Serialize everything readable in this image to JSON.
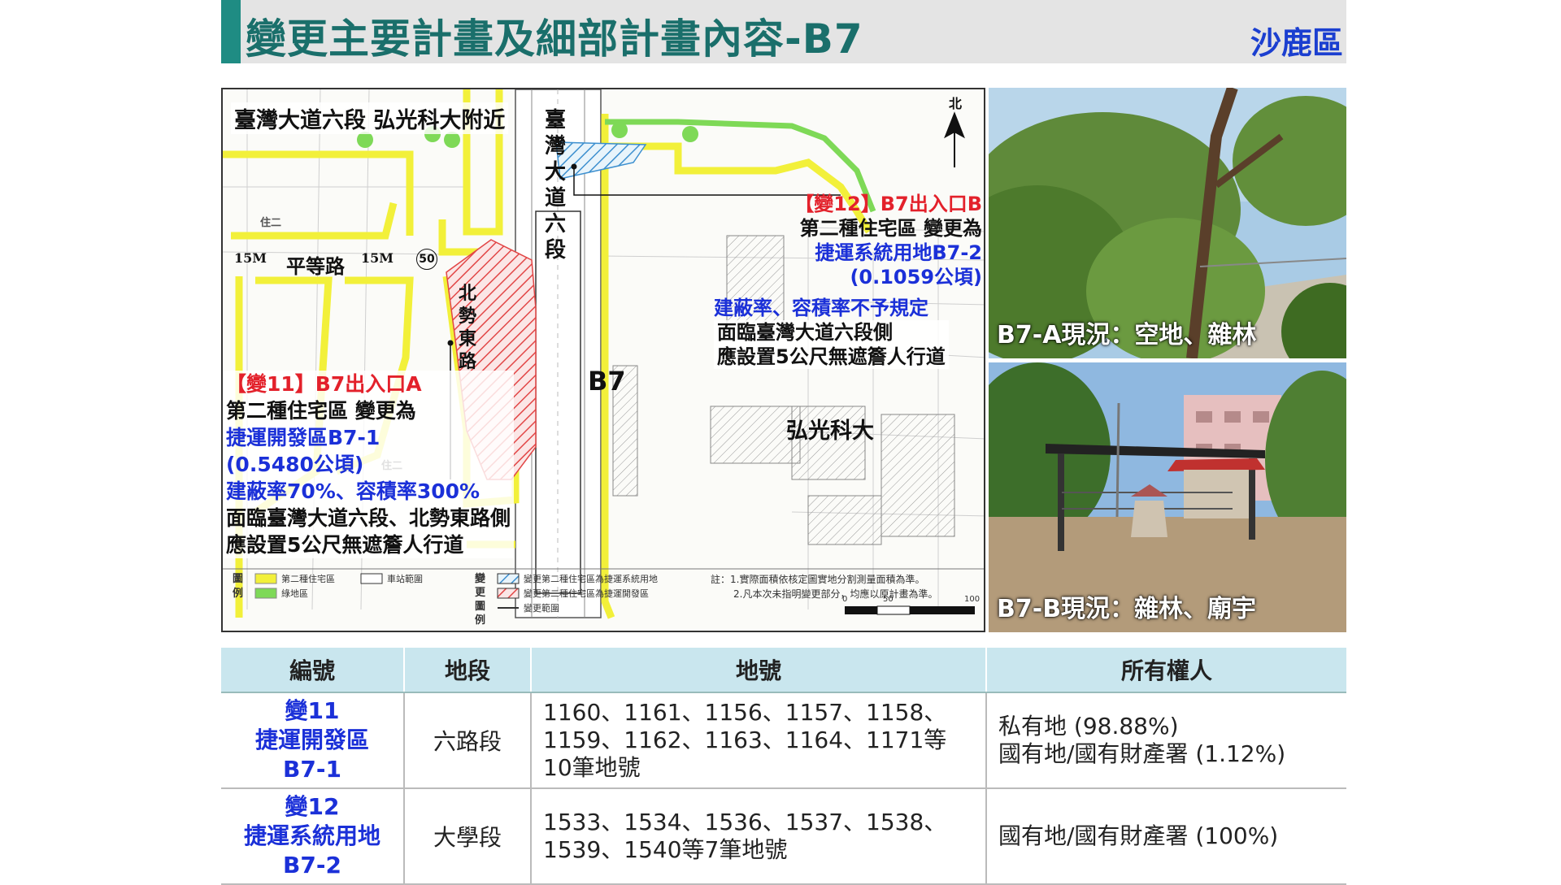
{
  "header": {
    "title": "變更主要計畫及細部計畫內容-B7",
    "district": "沙鹿區"
  },
  "map": {
    "location_label": "臺灣大道六段 弘光科大附近",
    "road_vertical": "臺灣大道六段",
    "road_horizontal": "平等路",
    "road_north": "北勢東路",
    "road_width_1": "15M",
    "road_width_2": "15M",
    "road_code": "50",
    "station": "B7",
    "campus": "弘光科大",
    "north": "北",
    "zone_left_1": "住二",
    "zone_left_2": "住二",
    "change12": {
      "title": "【變12】B7出入口B",
      "line1": "第二種住宅區 變更為",
      "line2": "捷運系統用地B7-2",
      "line3": "(0.1059公頃)",
      "line4": "建蔽率、容積率不予規定",
      "line5": "面臨臺灣大道六段側",
      "line6": "應設置5公尺無遮簷人行道"
    },
    "change11": {
      "title": "【變11】B7出入口A",
      "line1": "第二種住宅區 變更為",
      "line2": "捷運開發區B7-1",
      "line3": "(0.5480公頃)",
      "line4": "建蔽率70%、容積率300%",
      "line5": "面臨臺灣大道六段、北勢東路側",
      "line6": "應設置5公尺無遮簷人行道"
    },
    "legend": {
      "label_left": "圖例",
      "item1": "第二種住宅區",
      "item2": "綠地區",
      "item3": "車站範圍",
      "label_mid": "變更圖例",
      "item4": "變更第二種住宅區為捷運系統用地",
      "item5": "變更第二種住宅區為捷運開發區",
      "item6": "變更範圍",
      "note1": "註：1.實際面積依核定圖實地分割測量面積為準。",
      "note2": "2.凡本次未指明變更部分，均應以原計畫為準。",
      "scale_0": "0",
      "scale_50": "50",
      "scale_100": "100"
    }
  },
  "photos": {
    "a_caption": "B7-A現況：空地、雜林",
    "b_caption": "B7-B現況：雜林、廟宇"
  },
  "table": {
    "headers": [
      "編號",
      "地段",
      "地號",
      "所有權人"
    ],
    "rows": [
      {
        "id_line1": "變11",
        "id_line2": "捷運開發區",
        "id_line3": "B7-1",
        "section": "六路段",
        "lots": "1160、1161、1156、1157、1158、1159、1162、1163、1164、1171等10筆地號",
        "owner_line1": "私有地 (98.88%)",
        "owner_line2": "國有地/國有財產署 (1.12%)"
      },
      {
        "id_line1": "變12",
        "id_line2": "捷運系統用地",
        "id_line3": "B7-2",
        "section": "大學段",
        "lots": "1533、1534、1536、1537、1538、1539、1540等7筆地號",
        "owner_line1": "國有地/國有財產署 (100%)",
        "owner_line2": ""
      }
    ]
  },
  "colors": {
    "accent_bar": "#1f8c83",
    "title": "#1a6f6b",
    "district": "#1b3fd0",
    "red_label": "#e3212b",
    "blue_label": "#1b30d8",
    "table_header": "#c9e6ee",
    "zone_yellow": "#f2f03a",
    "green_dot": "#7ed957"
  }
}
